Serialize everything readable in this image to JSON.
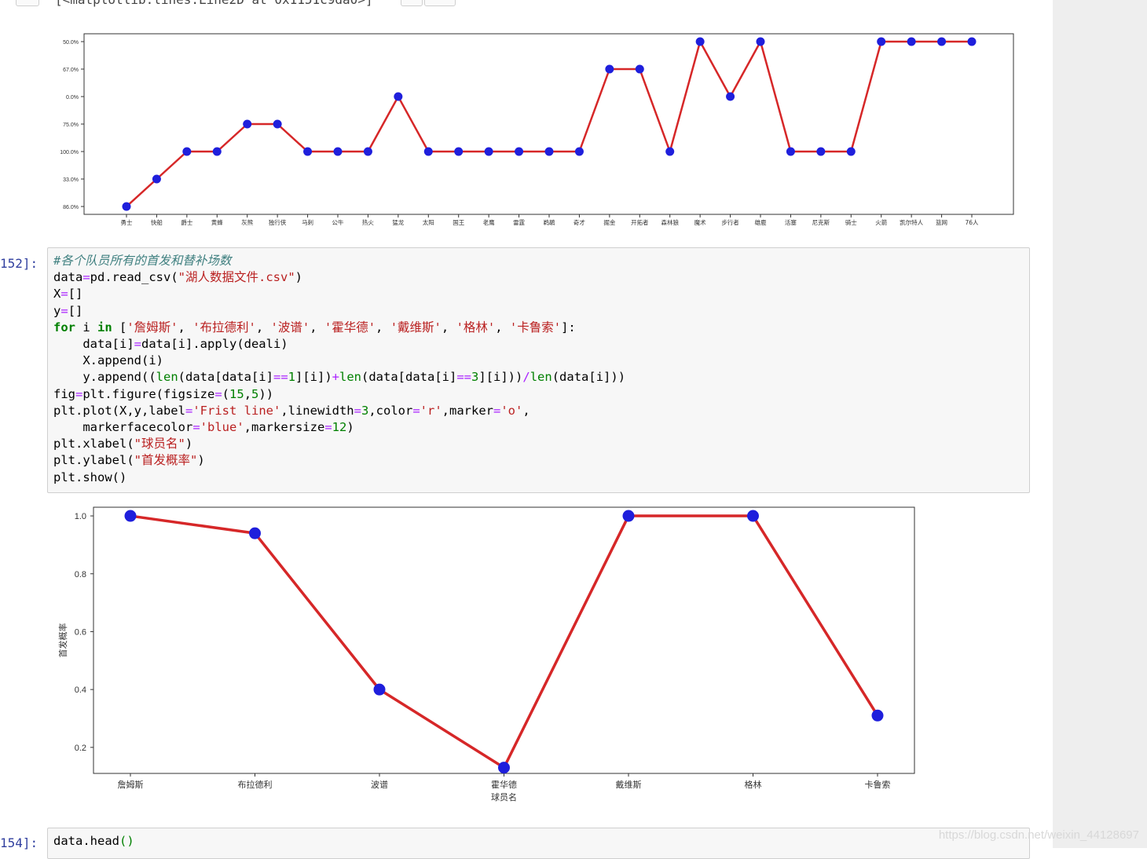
{
  "colors": {
    "line": "#d62728",
    "marker": "#1f1fdc",
    "prompt": "#303f9f",
    "cell_bg": "#f7f7f7"
  },
  "top_output": {
    "text": "[<matplotlib.lines.Line2D at 0x1151c9da0>]"
  },
  "chart_data": [
    {
      "type": "line",
      "title": "",
      "xlabel": "",
      "ylabel": "",
      "categories": [
        "勇士",
        "快船",
        "爵士",
        "黄蜂",
        "灰熊",
        "独行侠",
        "马刺",
        "公牛",
        "热火",
        "猛龙",
        "太阳",
        "国王",
        "老鹰",
        "雷霆",
        "鹈鹕",
        "奇才",
        "掘金",
        "开拓者",
        "森林狼",
        "魔术",
        "步行者",
        "雄鹿",
        "活塞",
        "尼克斯",
        "骑士",
        "火箭",
        "凯尔特人",
        "篮网",
        "76人"
      ],
      "y_tick_labels": [
        "50.0%",
        "67.0%",
        "0.0%",
        "75.0%",
        "100.0%",
        "33.0%",
        "86.0%"
      ],
      "series": [
        {
          "values": [
            "86.0%",
            "33.0%",
            "100.0%",
            "100.0%",
            "75.0%",
            "75.0%",
            "100.0%",
            "100.0%",
            "100.0%",
            "0.0%",
            "100.0%",
            "100.0%",
            "100.0%",
            "100.0%",
            "100.0%",
            "100.0%",
            "67.0%",
            "67.0%",
            "100.0%",
            "50.0%",
            "0.0%",
            "50.0%",
            "100.0%",
            "100.0%",
            "100.0%",
            "50.0%",
            "50.0%",
            "50.0%",
            "50.0%"
          ]
        }
      ],
      "grid": false
    },
    {
      "type": "line",
      "title": "",
      "xlabel": "球员名",
      "ylabel": "首发概率",
      "categories": [
        "詹姆斯",
        "布拉德利",
        "波谱",
        "霍华德",
        "戴维斯",
        "格林",
        "卡鲁索"
      ],
      "series": [
        {
          "name": "Frist line",
          "values": [
            1.0,
            0.94,
            0.4,
            0.13,
            1.0,
            1.0,
            0.31
          ]
        }
      ],
      "ylim": [
        0.11,
        1.03
      ],
      "yticks": [
        "0.2",
        "0.4",
        "0.6",
        "0.8",
        "1.0"
      ],
      "grid": false
    }
  ],
  "cells": {
    "cell152": {
      "prompt": "152]:",
      "lines": [
        [
          {
            "t": "#各个队员所有的首发和替补场数",
            "c": "cm"
          }
        ],
        [
          {
            "t": "data"
          },
          {
            "t": "=",
            "c": "op"
          },
          {
            "t": "pd.read_csv("
          },
          {
            "t": "\"湖人数据文件.csv\"",
            "c": "s"
          },
          {
            "t": ")"
          }
        ],
        [
          {
            "t": "X"
          },
          {
            "t": "=",
            "c": "op"
          },
          {
            "t": "[]"
          }
        ],
        [
          {
            "t": "y"
          },
          {
            "t": "=",
            "c": "op"
          },
          {
            "t": "[]"
          }
        ],
        [
          {
            "t": "for",
            "c": "kw"
          },
          {
            "t": " i "
          },
          {
            "t": "in",
            "c": "kw"
          },
          {
            "t": " ["
          },
          {
            "t": "'詹姆斯'",
            "c": "s"
          },
          {
            "t": ", "
          },
          {
            "t": "'布拉德利'",
            "c": "s"
          },
          {
            "t": ", "
          },
          {
            "t": "'波谱'",
            "c": "s"
          },
          {
            "t": ", "
          },
          {
            "t": "'霍华德'",
            "c": "s"
          },
          {
            "t": ", "
          },
          {
            "t": "'戴维斯'",
            "c": "s"
          },
          {
            "t": ", "
          },
          {
            "t": "'格林'",
            "c": "s"
          },
          {
            "t": ", "
          },
          {
            "t": "'卡鲁索'",
            "c": "s"
          },
          {
            "t": "]:"
          }
        ],
        [
          {
            "t": "    data[i]"
          },
          {
            "t": "=",
            "c": "op"
          },
          {
            "t": "data[i].apply(deali)"
          }
        ],
        [
          {
            "t": "    X.append(i)"
          }
        ],
        [
          {
            "t": "    y.append(("
          },
          {
            "t": "len",
            "c": "nb"
          },
          {
            "t": "(data[data[i]"
          },
          {
            "t": "==",
            "c": "op"
          },
          {
            "t": "1",
            "c": "n"
          },
          {
            "t": "][i])"
          },
          {
            "t": "+",
            "c": "op"
          },
          {
            "t": "len",
            "c": "nb"
          },
          {
            "t": "(data[data[i]"
          },
          {
            "t": "==",
            "c": "op"
          },
          {
            "t": "3",
            "c": "n"
          },
          {
            "t": "][i]))"
          },
          {
            "t": "/",
            "c": "op"
          },
          {
            "t": "len",
            "c": "nb"
          },
          {
            "t": "(data[i]))"
          }
        ],
        [
          {
            "t": "fig"
          },
          {
            "t": "=",
            "c": "op"
          },
          {
            "t": "plt.figure(figsize"
          },
          {
            "t": "=",
            "c": "op"
          },
          {
            "t": "("
          },
          {
            "t": "15",
            "c": "n"
          },
          {
            "t": ","
          },
          {
            "t": "5",
            "c": "n"
          },
          {
            "t": "))"
          }
        ],
        [
          {
            "t": "plt.plot(X,y,label"
          },
          {
            "t": "=",
            "c": "op"
          },
          {
            "t": "'Frist line'",
            "c": "s"
          },
          {
            "t": ",linewidth"
          },
          {
            "t": "=",
            "c": "op"
          },
          {
            "t": "3",
            "c": "n"
          },
          {
            "t": ",color"
          },
          {
            "t": "=",
            "c": "op"
          },
          {
            "t": "'r'",
            "c": "s"
          },
          {
            "t": ",marker"
          },
          {
            "t": "=",
            "c": "op"
          },
          {
            "t": "'o'",
            "c": "s"
          },
          {
            "t": ","
          }
        ],
        [
          {
            "t": "    markerfacecolor"
          },
          {
            "t": "=",
            "c": "op"
          },
          {
            "t": "'blue'",
            "c": "s"
          },
          {
            "t": ",markersize"
          },
          {
            "t": "=",
            "c": "op"
          },
          {
            "t": "12",
            "c": "n"
          },
          {
            "t": ")"
          }
        ],
        [
          {
            "t": "plt.xlabel("
          },
          {
            "t": "\"球员名\"",
            "c": "s"
          },
          {
            "t": ")"
          }
        ],
        [
          {
            "t": "plt.ylabel("
          },
          {
            "t": "\"首发概率\"",
            "c": "s"
          },
          {
            "t": ")"
          }
        ],
        [
          {
            "t": "plt.show()"
          }
        ]
      ]
    },
    "cell154": {
      "prompt": "154]:",
      "lines": [
        [
          {
            "t": "data.head"
          },
          {
            "t": "()",
            "c": "n"
          }
        ]
      ]
    }
  },
  "watermark": "https://blog.csdn.net/weixin_44128697"
}
